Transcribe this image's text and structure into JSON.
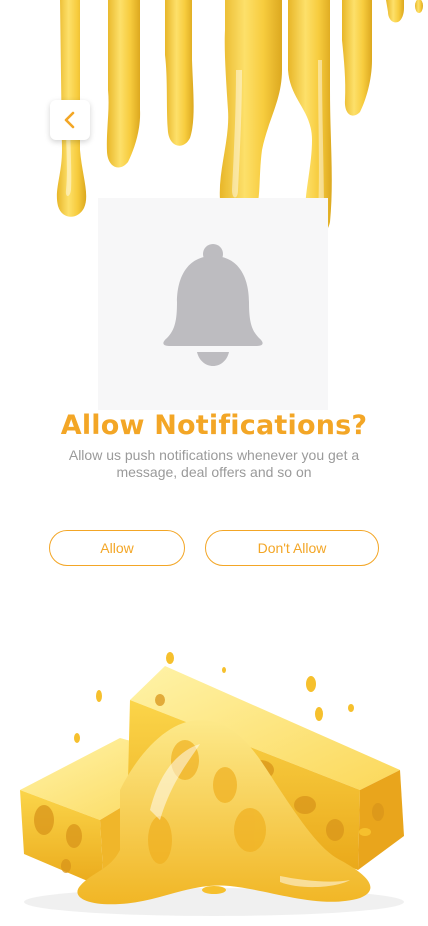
{
  "screen": {
    "title": "Allow Notifications?",
    "subtitle": "Allow us push notifications whenever you get a message, deal offers and so on"
  },
  "actions": {
    "allow_label": "Allow",
    "deny_label": "Don't Allow"
  },
  "icons": {
    "back": "chevron-left-icon",
    "bell": "bell-icon"
  },
  "colors": {
    "accent": "#f3a626",
    "subtitle": "#9a9a9a",
    "bell": "#bdbcc0"
  }
}
